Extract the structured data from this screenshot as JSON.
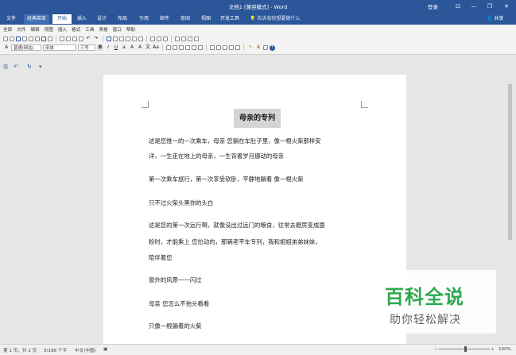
{
  "window": {
    "title": "文档1 [兼容模式] - Word",
    "login": "登录"
  },
  "tabs": [
    "文件",
    "经典菜单",
    "开始",
    "插入",
    "设计",
    "布局",
    "引用",
    "邮件",
    "审阅",
    "视图",
    "开发工具"
  ],
  "active_tab": "开始",
  "tell_me": "告诉我你想要做什么",
  "share_label": "共享",
  "classic_menu": [
    "全部",
    "文件",
    "编辑",
    "视图",
    "插入",
    "格式",
    "工具",
    "表格",
    "窗口",
    "帮助"
  ],
  "toolbar": {
    "style_value": "普通(网站)",
    "font_value": "宋体",
    "size_value": "三号"
  },
  "document": {
    "title": "母亲的专列",
    "paragraphs": [
      "这是您惟一的一次乘车，母亲 您躺在车肚子里，像一根火柴那样安",
      "详，一生走在地上的母亲，一生背着岁月挪动的母亲",
      "第一次乘车旅行，第一次享受软卧，平静地躺着 像一根火柴",
      "只不过火柴头黑你的头白",
      "这是您的第一次远行啊，就像没出过远门的粮食，往常去磨房变成面",
      "粉时，才能乘上 您拉动的，那辆老平车专列，我和姐姐弟弟妹妹，",
      "陪伴着您",
      "窗外的风景一一闪过",
      "母亲 您怎么不抬头看看",
      "只像一根躺着的火柴"
    ]
  },
  "statusbar": {
    "page": "第 1 页，共 1 页",
    "words": "5/198 个字",
    "language": "中文(中国)",
    "zoom": "100%"
  },
  "watermark": {
    "main": "百科全说",
    "sub": "助你轻松解决"
  }
}
